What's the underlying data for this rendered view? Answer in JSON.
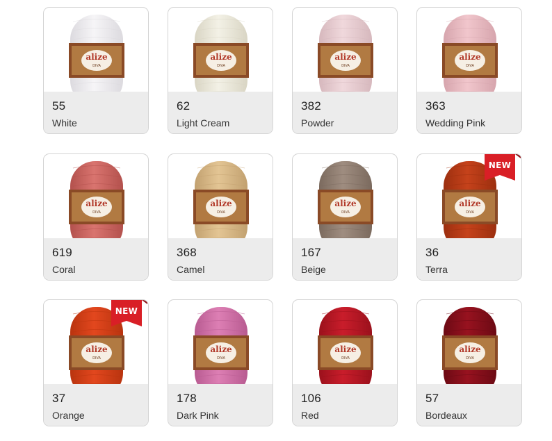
{
  "colors": {
    "card_border": "#d4d4d4",
    "info_band": "#ececec",
    "badge": "#d91f26",
    "label_brown": "#8a4a26",
    "label_gold": "#d2a25a"
  },
  "brand": {
    "logo_text": "alize",
    "line_text": "DIVA"
  },
  "badge_text": "NEW",
  "swatches": [
    {
      "code": "55",
      "name": "White",
      "yarn_color": "#f6f5f7",
      "shade": "#dcdadf",
      "is_new": false
    },
    {
      "code": "62",
      "name": "Light Cream",
      "yarn_color": "#f3f1e6",
      "shade": "#d9d5c4",
      "is_new": false
    },
    {
      "code": "382",
      "name": "Powder",
      "yarn_color": "#f0d8dc",
      "shade": "#d6b8bd",
      "is_new": false
    },
    {
      "code": "363",
      "name": "Wedding Pink",
      "yarn_color": "#f1c6cc",
      "shade": "#d6a5ad",
      "is_new": false
    },
    {
      "code": "619",
      "name": "Coral",
      "yarn_color": "#d9746f",
      "shade": "#b3514d",
      "is_new": false
    },
    {
      "code": "368",
      "name": "Camel",
      "yarn_color": "#e3c594",
      "shade": "#c2a170",
      "is_new": false
    },
    {
      "code": "167",
      "name": "Beige",
      "yarn_color": "#9f8d80",
      "shade": "#7b6a5e",
      "is_new": false
    },
    {
      "code": "36",
      "name": "Terra",
      "yarn_color": "#c5421b",
      "shade": "#9c2f0f",
      "is_new": true
    },
    {
      "code": "37",
      "name": "Orange",
      "yarn_color": "#e2471e",
      "shade": "#b9340f",
      "is_new": true
    },
    {
      "code": "178",
      "name": "Dark Pink",
      "yarn_color": "#dd7fb4",
      "shade": "#b85b91",
      "is_new": false
    },
    {
      "code": "106",
      "name": "Red",
      "yarn_color": "#c91d2b",
      "shade": "#9b111c",
      "is_new": false
    },
    {
      "code": "57",
      "name": "Bordeaux",
      "yarn_color": "#97121f",
      "shade": "#6c0a14",
      "is_new": false
    }
  ]
}
